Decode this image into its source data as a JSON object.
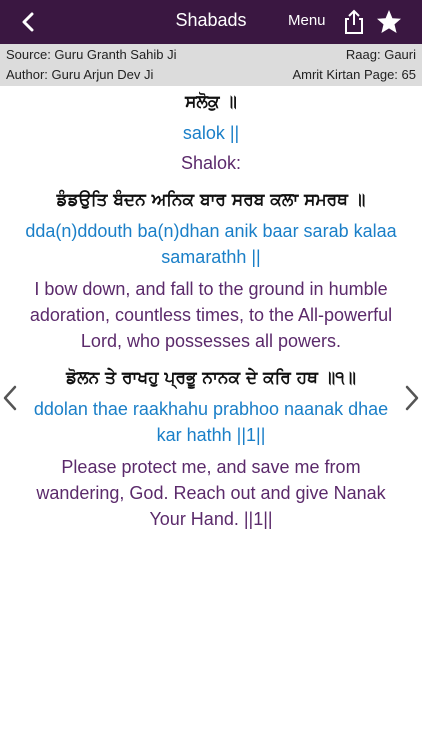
{
  "header": {
    "back_icon": "chevron-left-icon",
    "title": "Shabads",
    "menu_label": "Menu",
    "share_icon": "share-icon",
    "star_icon": "star-icon",
    "bar_color": "#3a1741"
  },
  "info": {
    "source": "Source: Guru Granth Sahib Ji",
    "raag": "Raag: Gauri",
    "author": "Author: Guru Arjun Dev Ji",
    "page": "Amrit Kirtan Page: 65"
  },
  "verses": {
    "heading_gurmukhi": "ਸਲੋਕੁ ॥",
    "heading_translit": "salok ||",
    "heading_english": "Shalok:",
    "v1_gurmukhi": "ਡੰਡਉਤਿ ਬੰਦਨ ਅਨਿਕ ਬਾਰ ਸਰਬ ਕਲਾ ਸਮਰਥ ॥",
    "v1_translit": "dda(n)ddouth ba(n)dhan anik baar sarab kalaa samarathh ||",
    "v1_english": "I bow down, and fall to the ground in humble adoration, countless times, to the All-powerful Lord, who possesses all powers.",
    "v2_gurmukhi": "ਡੋਲਨ ਤੇ ਰਾਖਹੁ ਪ੍ਰਭੂ ਨਾਨਕ ਦੇ ਕਰਿ ਹਥ ॥੧॥",
    "v2_translit": "ddolan thae raakhahu prabhoo naanak dhae kar hathh ||1||",
    "v2_english": "Please protect me, and save me from wandering, God. Reach out and give Nanak Your Hand. ||1||"
  },
  "nav": {
    "prev_icon": "chevron-left-icon",
    "next_icon": "chevron-right-icon"
  }
}
